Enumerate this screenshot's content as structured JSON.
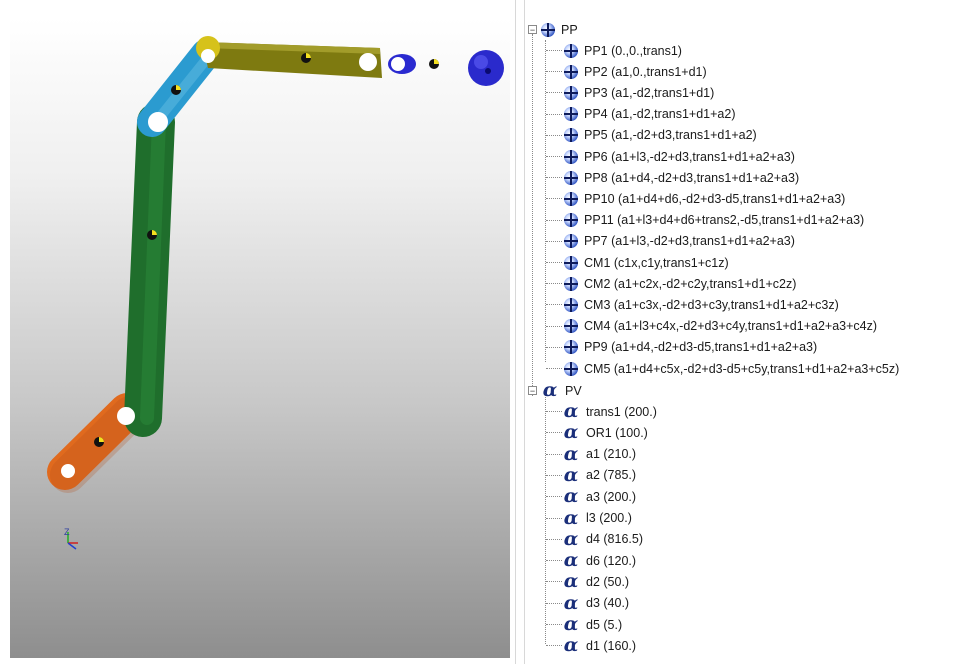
{
  "tree": {
    "pp_group": {
      "label": "PP",
      "items": [
        "PP1 (0.,0.,trans1)",
        "PP2 (a1,0.,trans1+d1)",
        "PP3 (a1,-d2,trans1+d1)",
        "PP4 (a1,-d2,trans1+d1+a2)",
        "PP5 (a1,-d2+d3,trans1+d1+a2)",
        "PP6 (a1+l3,-d2+d3,trans1+d1+a2+a3)",
        "PP8 (a1+d4,-d2+d3,trans1+d1+a2+a3)",
        "PP10 (a1+d4+d6,-d2+d3-d5,trans1+d1+a2+a3)",
        "PP11 (a1+l3+d4+d6+trans2,-d5,trans1+d1+a2+a3)",
        "PP7 (a1+l3,-d2+d3,trans1+d1+a2+a3)",
        "CM1 (c1x,c1y,trans1+c1z)",
        "CM2 (a1+c2x,-d2+c2y,trans1+d1+c2z)",
        "CM3 (a1+c3x,-d2+d3+c3y,trans1+d1+a2+c3z)",
        "CM4 (a1+l3+c4x,-d2+d3+c4y,trans1+d1+a2+a3+c4z)",
        "PP9 (a1+d4,-d2+d3-d5,trans1+d1+a2+a3)",
        "CM5 (a1+d4+c5x,-d2+d3-d5+c5y,trans1+d1+a2+a3+c5z)"
      ]
    },
    "pv_group": {
      "label": "PV",
      "items": [
        "trans1 (200.)",
        "OR1 (100.)",
        "a1 (210.)",
        "a2 (785.)",
        "a3 (200.)",
        "l3 (200.)",
        "d4 (816.5)",
        "d6 (120.)",
        "d2 (50.)",
        "d3 (40.)",
        "d5 (5.)",
        "d1 (160.)"
      ]
    },
    "expander_symbol": "−",
    "alpha_symbol": "α",
    "pp_icon": "point-cross-icon",
    "pv_icon": "alpha-parameter-icon"
  },
  "viewport": {
    "axis_label": "Z",
    "link_colors": {
      "base": "#e06a1e",
      "link2": "#1f6e2c",
      "link3": "#2b9bd0",
      "link4": "#7e7a10",
      "tool": "#2a2ad0"
    }
  }
}
